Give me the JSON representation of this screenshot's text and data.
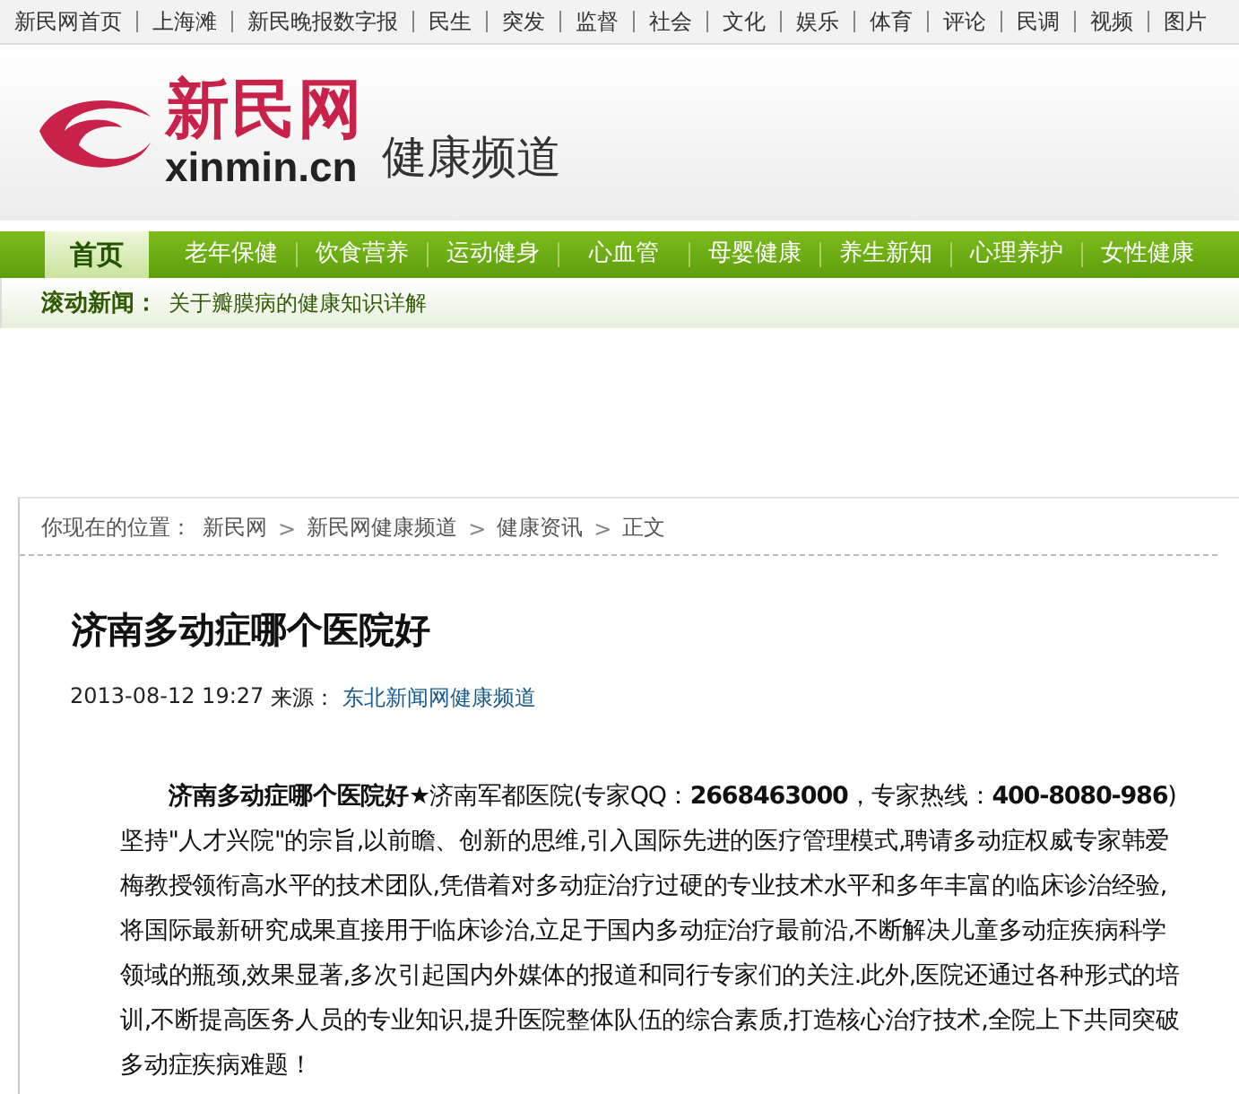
{
  "top_links": [
    "新民网首页",
    "上海滩",
    "新民晚报数字报",
    "民生",
    "突发",
    "监督",
    "社会",
    "文化",
    "娱乐",
    "体育",
    "评论",
    "民调",
    "视频",
    "图片"
  ],
  "header": {
    "logo_name": "新民网",
    "logo_domain": "xinmin.cn",
    "channel": "健康频道"
  },
  "nav": [
    {
      "label": "首页",
      "selected": true
    },
    {
      "label": "老年保健",
      "selected": false
    },
    {
      "label": "饮食营养",
      "selected": false
    },
    {
      "label": "运动健身",
      "selected": false
    },
    {
      "label": "心血管",
      "selected": false
    },
    {
      "label": "母婴健康",
      "selected": false
    },
    {
      "label": "养生新知",
      "selected": false
    },
    {
      "label": "心理养护",
      "selected": false
    },
    {
      "label": "女性健康",
      "selected": false
    }
  ],
  "ticker": {
    "label": "滚动新闻：",
    "headline": "关于瓣膜病的健康知识详解"
  },
  "breadcrumb": {
    "prefix": "你现在的位置：",
    "items": [
      "新民网",
      "新民网健康频道",
      "健康资讯",
      "正文"
    ],
    "separator": ">"
  },
  "article": {
    "title": "济南多动症哪个医院好",
    "date": "2013-08-12 19:27",
    "source_label": "来源：",
    "source": "东北新闻网健康频道",
    "body": "**济南多动症哪个医院好★**济南军都医院(专家QQ：**2668463000**，专家热线：**400-8080-986**)坚持\"人才兴院\"的宗旨,以前瞻、创新的思维,引入国际先进的医疗管理模式,聘请多动症权威专家韩爱梅教授领衔高水平的技术团队,凭借着对多动症治疗过硬的专业技术水平和多年丰富的临床诊治经验,将国际最新研究成果直接用于临床诊治,立足于国内多动症治疗最前沿,不断解决儿童多动症疾病科学领域的瓶颈,效果显著,多次引起国内外媒体的报道和同行专家们的关注.此外,医院还通过各种形式的培训,不断提高医务人员的专业知识,提升医院整体队伍的综合素质,打造核心治疗技术,全院上下共同突破多动症疾病难题！"
  }
}
